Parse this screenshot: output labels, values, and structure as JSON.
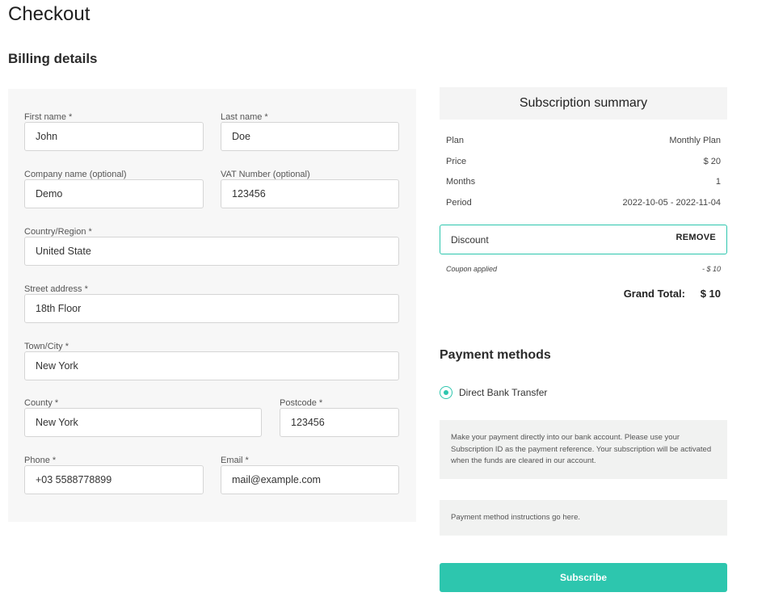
{
  "page": {
    "title": "Checkout"
  },
  "billing": {
    "title": "Billing details",
    "fields": {
      "first_name": {
        "label": "First name *",
        "value": "John"
      },
      "last_name": {
        "label": "Last name *",
        "value": "Doe"
      },
      "company": {
        "label": "Company name (optional)",
        "value": "Demo"
      },
      "vat": {
        "label": "VAT Number (optional)",
        "value": "123456"
      },
      "country": {
        "label": "Country/Region *",
        "value": "United State"
      },
      "street": {
        "label": "Street address *",
        "value": "18th Floor"
      },
      "town": {
        "label": "Town/City *",
        "value": "New York"
      },
      "county": {
        "label": "County *",
        "value": "New York"
      },
      "postcode": {
        "label": "Postcode *",
        "value": "123456"
      },
      "phone": {
        "label": "Phone *",
        "value": "+03 5588778899"
      },
      "email": {
        "label": "Email *",
        "value": "mail@example.com"
      }
    }
  },
  "summary": {
    "title": "Subscription summary",
    "rows": [
      {
        "key": "Plan",
        "value": "Monthly Plan"
      },
      {
        "key": "Price",
        "value": "$ 20"
      },
      {
        "key": "Months",
        "value": "1"
      },
      {
        "key": "Period",
        "value": "2022-10-05 - 2022-11-04"
      }
    ],
    "discount": {
      "label": "Discount",
      "action": "REMOVE"
    },
    "coupon": {
      "label": "Coupon applied",
      "value": "- $ 10"
    },
    "grand_total": {
      "label": "Grand Total:",
      "value": "$ 10"
    }
  },
  "payment": {
    "title": "Payment methods",
    "method": {
      "label": "Direct Bank Transfer",
      "selected": true
    },
    "description": "Make your payment directly into our bank account. Please use your Subscription ID as the payment reference. Your subscription will be activated when the funds are cleared in our account.",
    "instructions": "Payment method instructions go here."
  },
  "actions": {
    "subscribe": "Subscribe"
  },
  "colors": {
    "accent": "#2dc6ae",
    "panel_bg": "#f7f7f7",
    "info_bg": "#f1f2f1"
  }
}
